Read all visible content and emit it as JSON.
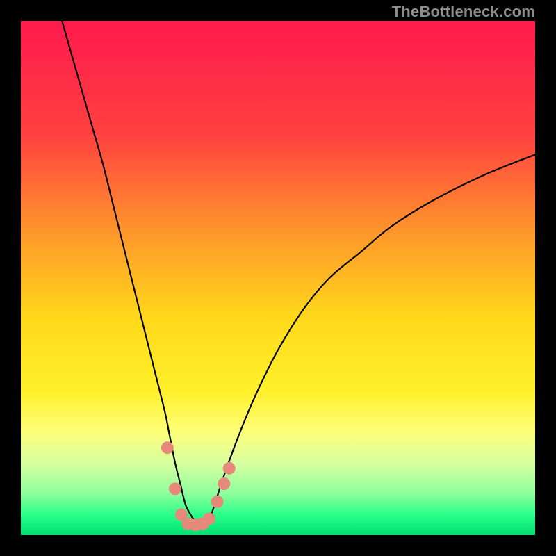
{
  "watermark": "TheBottleneck.com",
  "chart_data": {
    "type": "line",
    "title": "",
    "xlabel": "",
    "ylabel": "",
    "xlim": [
      0,
      100
    ],
    "ylim": [
      0,
      100
    ],
    "grid": false,
    "legend": false,
    "gradient_stops": [
      {
        "offset": 0.0,
        "color": "#ff1a4d"
      },
      {
        "offset": 0.22,
        "color": "#ff4040"
      },
      {
        "offset": 0.42,
        "color": "#ff9a2a"
      },
      {
        "offset": 0.58,
        "color": "#ffd91a"
      },
      {
        "offset": 0.72,
        "color": "#fff02a"
      },
      {
        "offset": 0.8,
        "color": "#fdff7a"
      },
      {
        "offset": 0.86,
        "color": "#d8ffa0"
      },
      {
        "offset": 0.92,
        "color": "#8cff9c"
      },
      {
        "offset": 0.96,
        "color": "#2aff8a"
      },
      {
        "offset": 1.0,
        "color": "#00e070"
      }
    ],
    "series": [
      {
        "name": "bottleneck-curve",
        "x": [
          8,
          10,
          12,
          14,
          16,
          18,
          20,
          22,
          24,
          26,
          28,
          29,
          30,
          31,
          32,
          33,
          34,
          35,
          36,
          37,
          38,
          40,
          43,
          46,
          50,
          55,
          60,
          66,
          72,
          80,
          90,
          100
        ],
        "y": [
          100,
          93,
          86,
          79,
          72,
          64,
          56,
          48,
          40,
          32,
          24,
          19,
          14,
          10,
          6,
          4,
          2.5,
          2,
          2.5,
          4,
          7,
          13,
          21,
          28,
          36,
          44,
          50,
          55,
          60,
          65,
          70,
          74
        ]
      }
    ],
    "markers": {
      "name": "curve-dots",
      "color": "#e58a7a",
      "points": [
        {
          "x": 28.5,
          "y": 17
        },
        {
          "x": 30.0,
          "y": 9
        },
        {
          "x": 31.2,
          "y": 4
        },
        {
          "x": 32.5,
          "y": 2.2
        },
        {
          "x": 34.0,
          "y": 2
        },
        {
          "x": 35.4,
          "y": 2.2
        },
        {
          "x": 36.6,
          "y": 3.2
        },
        {
          "x": 38.2,
          "y": 6.5
        },
        {
          "x": 39.5,
          "y": 10
        },
        {
          "x": 40.5,
          "y": 13
        }
      ]
    }
  }
}
